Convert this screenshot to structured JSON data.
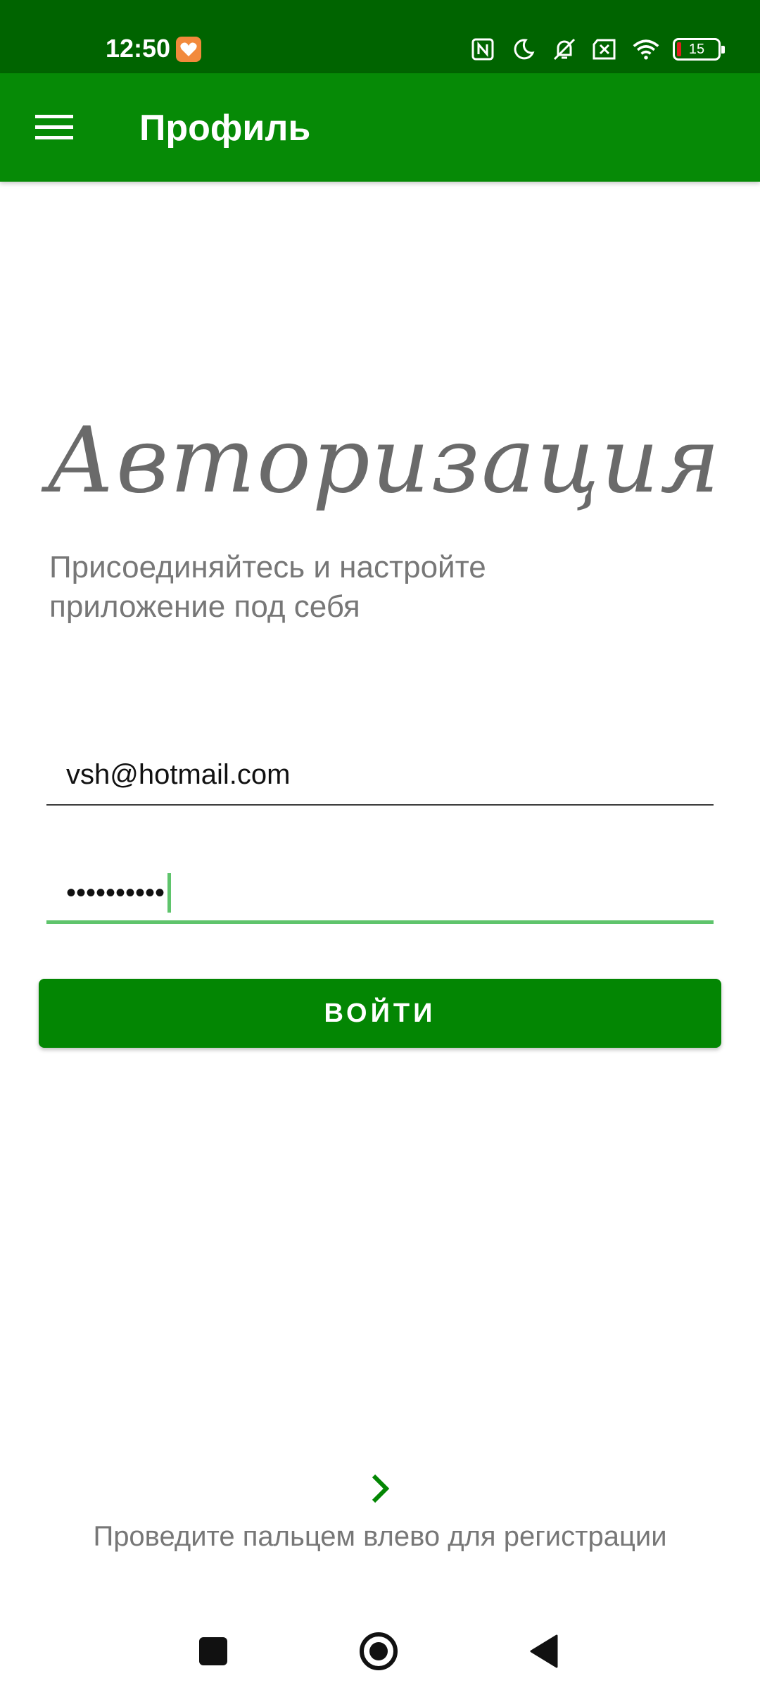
{
  "status_bar": {
    "time": "12:50",
    "battery_level": "15",
    "icons": [
      "health-app-icon",
      "nfc-icon",
      "moon-icon",
      "bell-off-icon",
      "sim-off-icon",
      "wifi-icon",
      "battery-icon"
    ]
  },
  "app_bar": {
    "title": "Профиль",
    "menu_icon": "hamburger-menu-icon"
  },
  "auth": {
    "title": "Авторизация",
    "subtitle": "Присоединяйтесь и настройте приложение под себя",
    "email_value": "vsh@hotmail.com",
    "password_mask": "••••••••••",
    "login_label": "ВОЙТИ"
  },
  "swipe": {
    "icon": "chevron-right-icon",
    "hint": "Проведите пальцем влево для регистрации"
  },
  "nav_bar": {
    "icons": [
      "recent-apps-icon",
      "home-icon",
      "back-icon"
    ]
  },
  "colors": {
    "status_bar": "#006400",
    "app_bar": "#068a06",
    "button": "#038603",
    "focus_underline": "#5fc46c",
    "text_gray": "#777777"
  }
}
